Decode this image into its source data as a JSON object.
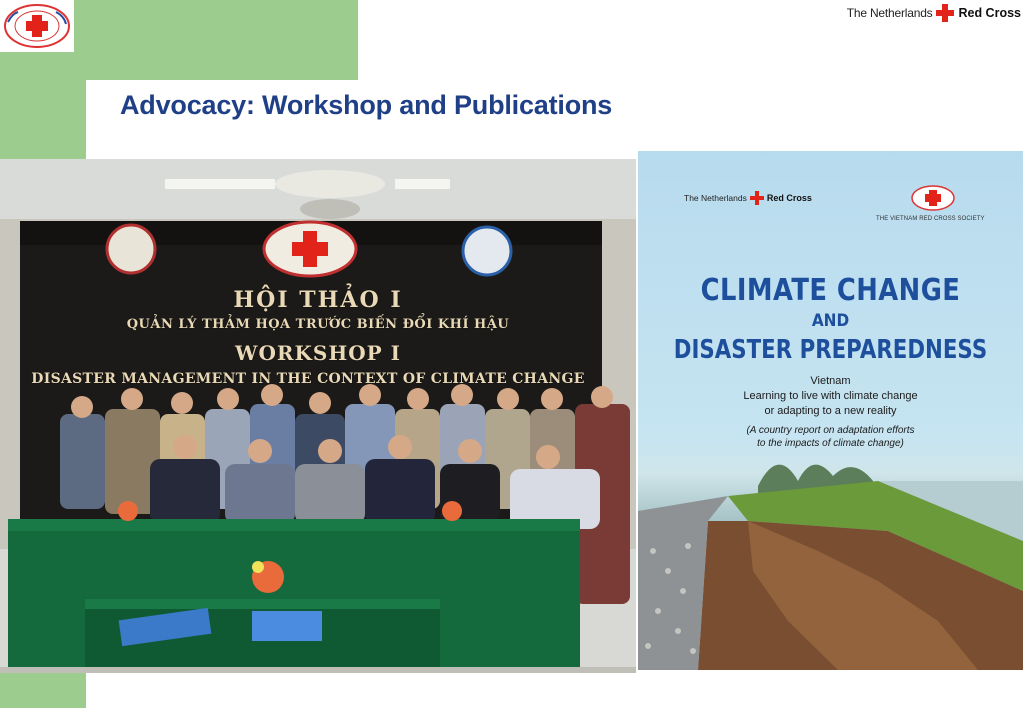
{
  "header": {
    "brand_country": "The Netherlands",
    "brand_org": "Red Cross",
    "logo_icon": "vietnam-red-cross-emblem"
  },
  "slide": {
    "title": "Advocacy: Workshop and Publications"
  },
  "photo": {
    "banner_line1": "HỘI THẢO I",
    "banner_line2": "QUẢN LÝ THẢM HỌA TRƯỚC BIẾN ĐỔI KHÍ HẬU",
    "banner_line3": "WORKSHOP I",
    "banner_line4": "DISASTER MANAGEMENT IN THE CONTEXT OF CLIMATE CHANGE"
  },
  "cover": {
    "brand_country": "The Netherlands",
    "brand_org": "Red Cross",
    "society": "THE VIETNAM RED CROSS SOCIETY",
    "title_line1": "CLIMATE CHANGE",
    "title_line2": "AND",
    "title_line3": "DISASTER PREPAREDNESS",
    "subtitle_line1": "Vietnam",
    "subtitle_line2": "Learning to live with climate change",
    "subtitle_line3": "or adapting to a new reality",
    "note_line1": "(A country report on adaptation efforts",
    "note_line2": "to the impacts of climate change)"
  },
  "colors": {
    "accent_green": "#9dcd8e",
    "title_blue": "#1f3f86",
    "cover_blue": "#1d4f9c",
    "red_cross": "#e2231a"
  }
}
